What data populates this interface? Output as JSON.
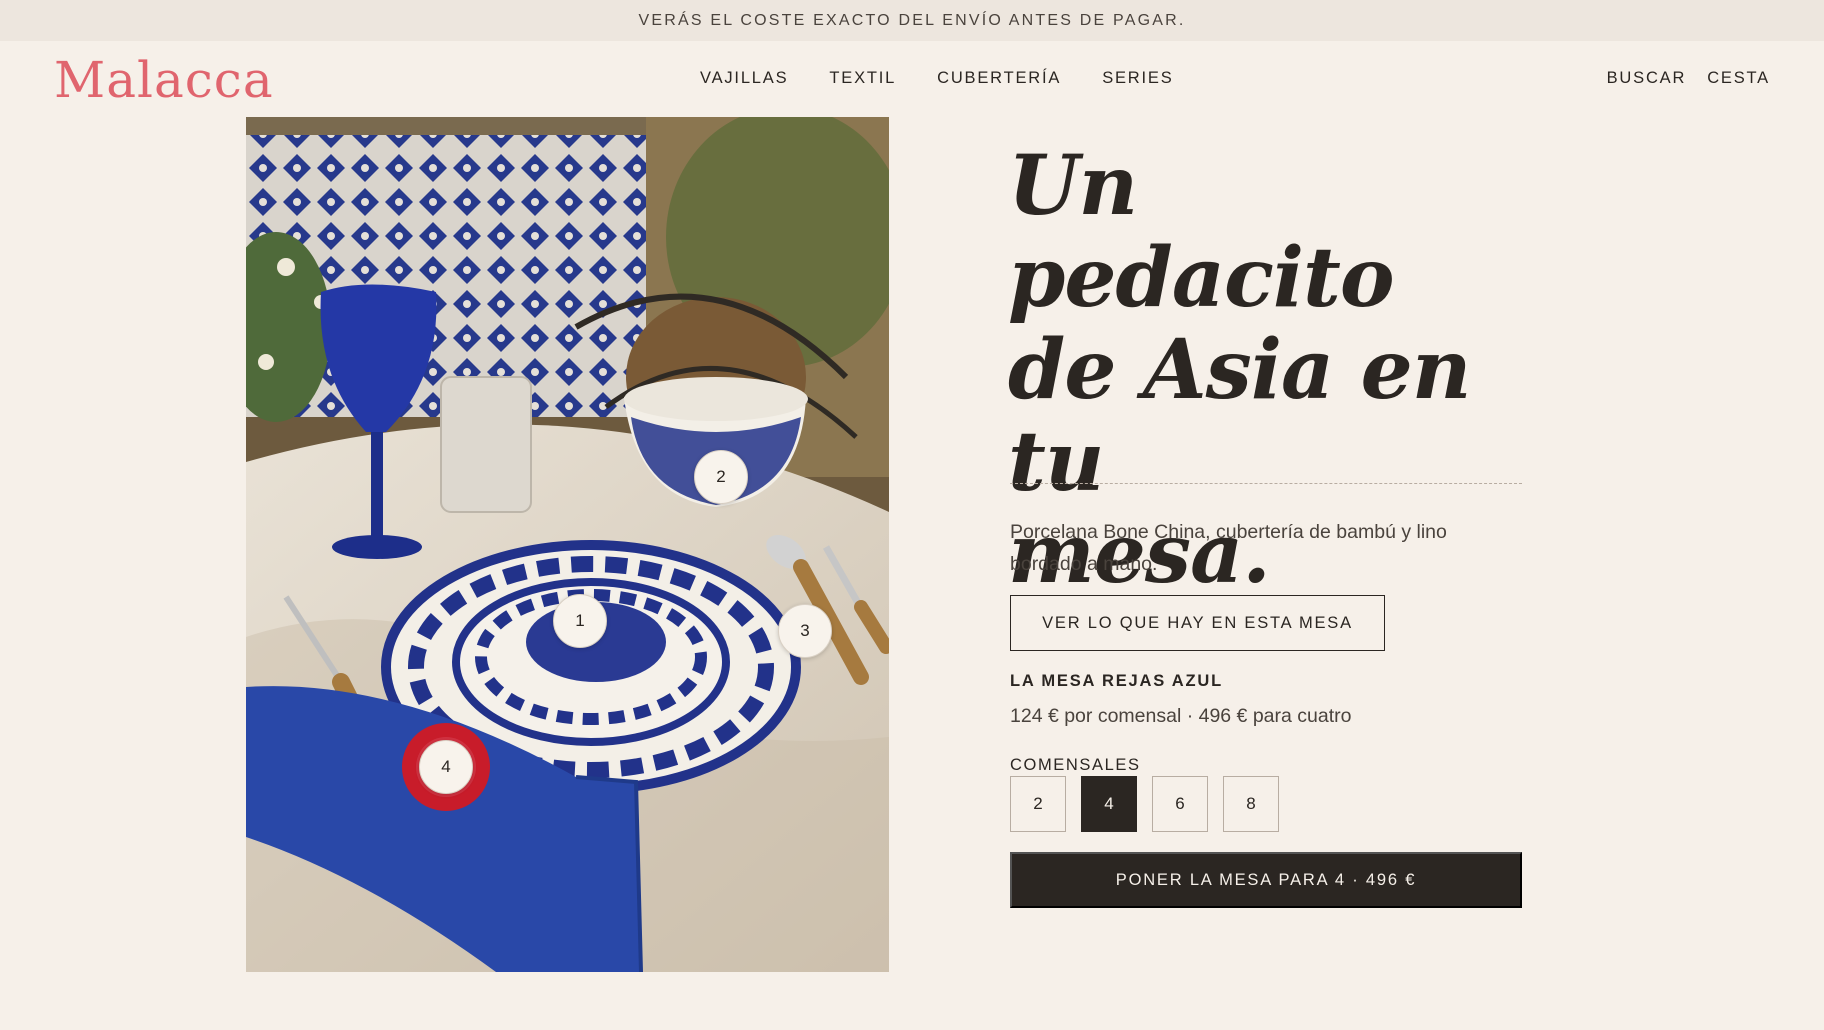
{
  "announcement": "VERÁS EL COSTE EXACTO DEL ENVÍO ANTES DE PAGAR.",
  "brand": {
    "logo": "Malacca",
    "color": "#e0656e"
  },
  "nav": [
    "VAJILLAS",
    "TEXTIL",
    "CUBERTERÍA",
    "SERIES"
  ],
  "utilities": {
    "search": "BUSCAR",
    "cart": "CESTA"
  },
  "photo": {
    "hotspots": [
      {
        "label": "1"
      },
      {
        "label": "2"
      },
      {
        "label": "3"
      },
      {
        "label": "4"
      }
    ]
  },
  "hero": {
    "headline_line1": "Un pedacito",
    "headline_line2": "de Asia en tu",
    "headline_line3": "mesa.",
    "description": "Porcelana Bone China, cubertería de bambú y lino bordado a mano.",
    "view_button": "VER LO QUE HAY EN ESTA MESA",
    "set_name": "LA MESA REJAS AZUL",
    "price_line": "124 € por comensal · 496 € para cuatro",
    "diners_label": "COMENSALES",
    "diners_options": [
      "2",
      "4",
      "6",
      "8"
    ],
    "diners_selected": "4",
    "cta": "PONER LA MESA PARA 4 · 496 €"
  },
  "colors": {
    "background": "#f6f0e9",
    "announcement_bg": "#ede6de",
    "ink": "#2b2622",
    "accent": "#e0656e",
    "cobalt": "#1f3a8a"
  }
}
